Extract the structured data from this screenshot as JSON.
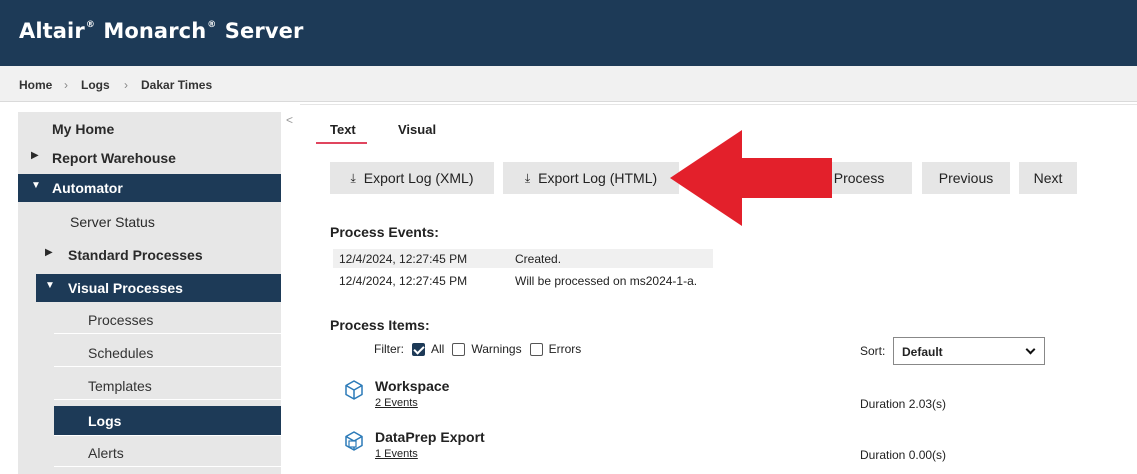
{
  "app": {
    "brand_name": "Altair",
    "brand_reg": "®",
    "brand_product": "Monarch",
    "brand_server": "Server"
  },
  "breadcrumb": [
    "Home",
    "Logs",
    "Dakar Times"
  ],
  "sidebar": {
    "my_home": "My Home",
    "report_warehouse": "Report Warehouse",
    "automator": "Automator",
    "server_status": "Server Status",
    "standard_processes": "Standard Processes",
    "visual_processes": "Visual Processes",
    "processes": "Processes",
    "schedules": "Schedules",
    "templates": "Templates",
    "logs": "Logs",
    "alerts": "Alerts",
    "collapse_glyph": "<"
  },
  "tabs": {
    "text": "Text",
    "visual": "Visual",
    "active": "Text"
  },
  "toolbar": {
    "export_xml": "Export Log (XML)",
    "export_html": "Export Log (HTML)",
    "go_to_process": "Go to Process",
    "previous": "Previous",
    "next": "Next",
    "export_icon": "download-icon"
  },
  "events": {
    "heading": "Process Events:",
    "rows": [
      {
        "date": "12/4/2024, 12:27:45 PM",
        "message": "Created."
      },
      {
        "date": "12/4/2024, 12:27:45 PM",
        "message": "Will be processed on ms2024-1-a."
      }
    ]
  },
  "items": {
    "heading": "Process Items:",
    "filter_label": "Filter:",
    "filters": [
      {
        "label": "All",
        "checked": true
      },
      {
        "label": "Warnings",
        "checked": false
      },
      {
        "label": "Errors",
        "checked": false
      }
    ],
    "sort_label": "Sort:",
    "sort_value": "Default",
    "list": [
      {
        "title": "Workspace",
        "events": "2 Events",
        "duration": "Duration 2.03(s)",
        "icon": "cube-icon"
      },
      {
        "title": "DataPrep Export",
        "events": "1 Events",
        "duration": "Duration 0.00(s)",
        "icon": "cube-export-icon"
      }
    ]
  },
  "colors": {
    "navy": "#1d3a57",
    "tab_accent": "#e0455e",
    "arrow_red": "#e3202b",
    "icon_blue": "#2b7ab8"
  }
}
